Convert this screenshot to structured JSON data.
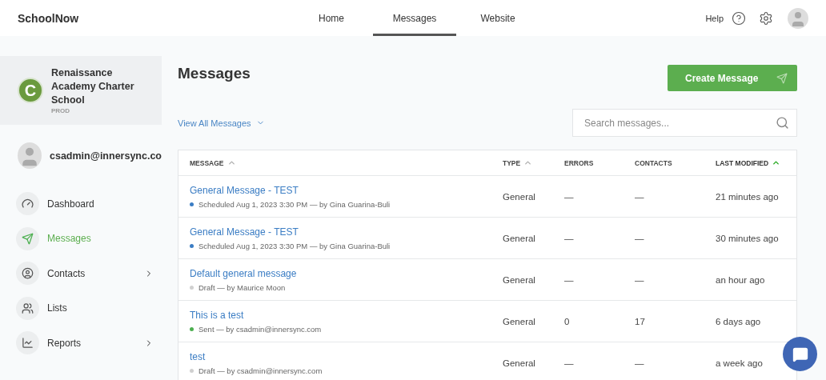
{
  "brand": "SchoolNow",
  "nav": [
    {
      "label": "Home",
      "selected": false
    },
    {
      "label": "Messages",
      "selected": true
    },
    {
      "label": "Website",
      "selected": false
    }
  ],
  "help": "Help",
  "org": {
    "initial": "C",
    "name": "Renaissance Academy Charter School",
    "env": "PROD"
  },
  "user": "csadmin@innersync.co",
  "sidebar": {
    "items": [
      {
        "label": "Dashboard",
        "selected": false,
        "has_submenu": false
      },
      {
        "label": "Messages",
        "selected": true,
        "has_submenu": false
      },
      {
        "label": "Contacts",
        "selected": false,
        "has_submenu": true
      },
      {
        "label": "Lists",
        "selected": false,
        "has_submenu": false
      },
      {
        "label": "Reports",
        "selected": false,
        "has_submenu": true
      }
    ]
  },
  "title": "Messages",
  "create_button": "Create Message",
  "filter": "View All Messages",
  "search": {
    "placeholder": "Search messages..."
  },
  "table": {
    "columns": [
      {
        "label": "MESSAGE",
        "sorted": true,
        "active": false
      },
      {
        "label": "TYPE",
        "sorted": true,
        "active": false
      },
      {
        "label": "ERRORS",
        "sorted": false,
        "active": false
      },
      {
        "label": "CONTACTS",
        "sorted": false,
        "active": false
      },
      {
        "label": "LAST MODIFIED",
        "sorted": true,
        "active": true
      }
    ],
    "rows": [
      {
        "title": "General Message - TEST",
        "status": "Scheduled Aug 1, 2023 3:30 PM — by Gina Guarina-Buli",
        "color": "#3b7dc4",
        "type": "General",
        "errors": "—",
        "contacts": "—",
        "modified": "21 minutes ago"
      },
      {
        "title": "General Message - TEST",
        "status": "Scheduled Aug 1, 2023 3:30 PM — by Gina Guarina-Buli",
        "color": "#3b7dc4",
        "type": "General",
        "errors": "—",
        "contacts": "—",
        "modified": "30 minutes ago"
      },
      {
        "title": "Default general message",
        "status": "Draft — by Maurice Moon",
        "color": "#d0d0d0",
        "type": "General",
        "errors": "—",
        "contacts": "—",
        "modified": "an hour ago"
      },
      {
        "title": "This is a test",
        "status": "Sent — by csadmin@innersync.com",
        "color": "#4caf50",
        "type": "General",
        "errors": "0",
        "contacts": "17",
        "modified": "6 days ago"
      },
      {
        "title": "test",
        "status": "Draft — by csadmin@innersync.com",
        "color": "#d0d0d0",
        "type": "General",
        "errors": "—",
        "contacts": "—",
        "modified": "a week ago"
      }
    ]
  }
}
